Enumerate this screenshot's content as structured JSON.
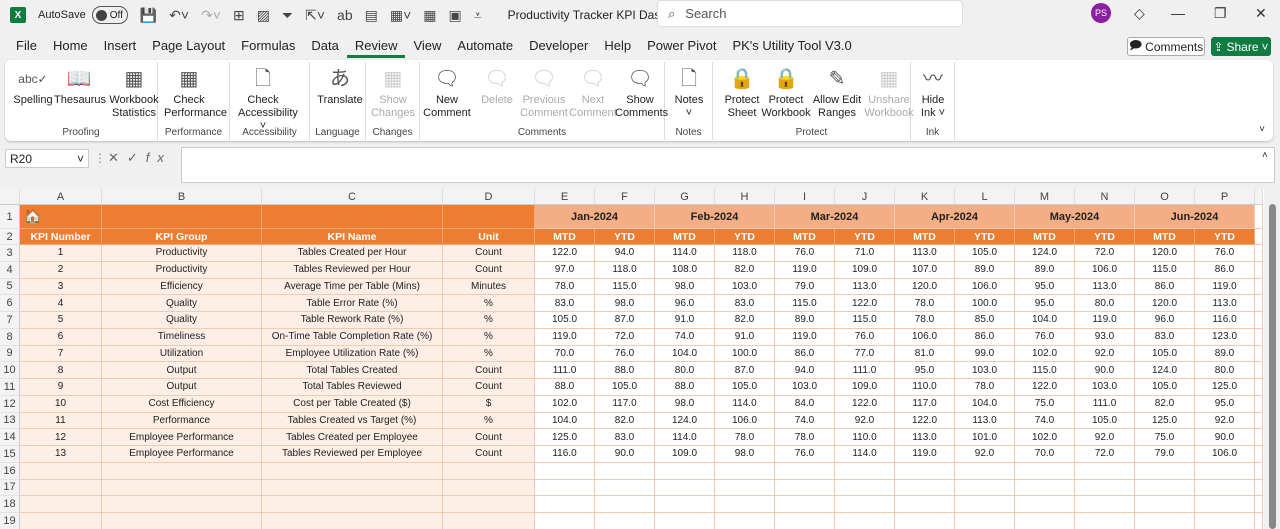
{
  "app": {
    "autosave_label": "AutoSave",
    "autosave_state": "Off",
    "doc_title": "Productivity Tracker KPI Dashb...",
    "search_placeholder": "Search",
    "avatar": "PS"
  },
  "menu_tabs": [
    "File",
    "Home",
    "Insert",
    "Page Layout",
    "Formulas",
    "Data",
    "Review",
    "View",
    "Automate",
    "Developer",
    "Help",
    "Power Pivot",
    "PK's Utility Tool V3.0"
  ],
  "active_tab": "Review",
  "header_buttons": {
    "comments": "Comments",
    "share": "Share"
  },
  "ribbon": {
    "groups": [
      {
        "label": "Proofing",
        "buttons": [
          {
            "l1": "Spelling",
            "l2": "",
            "icon": "spelling-icon",
            "glyph": "abc✓",
            "enabled": true
          },
          {
            "l1": "Thesaurus",
            "l2": "",
            "icon": "thesaurus-icon",
            "glyph": "📖",
            "enabled": true
          },
          {
            "l1": "Workbook",
            "l2": "Statistics",
            "icon": "workbook-statistics-icon",
            "glyph": "▦",
            "enabled": true
          }
        ]
      },
      {
        "label": "Performance",
        "buttons": [
          {
            "l1": "Check",
            "l2": "Performance",
            "icon": "check-performance-icon",
            "glyph": "▦",
            "enabled": true
          }
        ]
      },
      {
        "label": "Accessibility",
        "buttons": [
          {
            "l1": "Check",
            "l2": "Accessibility ˅",
            "icon": "check-accessibility-icon",
            "glyph": "🗋",
            "enabled": true
          }
        ]
      },
      {
        "label": "Language",
        "buttons": [
          {
            "l1": "Translate",
            "l2": "",
            "icon": "translate-icon",
            "glyph": "あ",
            "enabled": true
          }
        ]
      },
      {
        "label": "Changes",
        "buttons": [
          {
            "l1": "Show",
            "l2": "Changes",
            "icon": "show-changes-icon",
            "glyph": "▦",
            "enabled": false
          }
        ]
      },
      {
        "label": "Comments",
        "buttons": [
          {
            "l1": "New",
            "l2": "Comment",
            "icon": "new-comment-icon",
            "glyph": "🗨",
            "enabled": true
          },
          {
            "l1": "Delete",
            "l2": "",
            "icon": "delete-comment-icon",
            "glyph": "🗨",
            "enabled": false
          },
          {
            "l1": "Previous",
            "l2": "Comment",
            "icon": "previous-comment-icon",
            "glyph": "🗨",
            "enabled": false
          },
          {
            "l1": "Next",
            "l2": "Comment",
            "icon": "next-comment-icon",
            "glyph": "🗨",
            "enabled": false
          },
          {
            "l1": "Show",
            "l2": "Comments",
            "icon": "show-comments-icon",
            "glyph": "🗨",
            "enabled": true
          }
        ]
      },
      {
        "label": "Notes",
        "buttons": [
          {
            "l1": "Notes",
            "l2": "˅",
            "icon": "notes-icon",
            "glyph": "🗋",
            "enabled": true
          }
        ]
      },
      {
        "label": "Protect",
        "buttons": [
          {
            "l1": "Protect",
            "l2": "Sheet",
            "icon": "protect-sheet-icon",
            "glyph": "🔒",
            "enabled": true
          },
          {
            "l1": "Protect",
            "l2": "Workbook",
            "icon": "protect-workbook-icon",
            "glyph": "🔒",
            "enabled": true
          },
          {
            "l1": "Allow Edit",
            "l2": "Ranges",
            "icon": "allow-edit-ranges-icon",
            "glyph": "✎",
            "enabled": true
          },
          {
            "l1": "Unshare",
            "l2": "Workbook",
            "icon": "unshare-workbook-icon",
            "glyph": "▦",
            "enabled": false
          }
        ]
      },
      {
        "label": "Ink",
        "buttons": [
          {
            "l1": "Hide",
            "l2": "Ink ˅",
            "icon": "hide-ink-icon",
            "glyph": "〰",
            "enabled": true
          }
        ]
      }
    ]
  },
  "formula_bar": {
    "name_box": "R20",
    "formula": ""
  },
  "sheet": {
    "columns": [
      "A",
      "B",
      "C",
      "D",
      "E",
      "F",
      "G",
      "H",
      "I",
      "J",
      "K",
      "L",
      "M",
      "N",
      "O",
      "P"
    ],
    "row_numbers": [
      1,
      2,
      3,
      4,
      5,
      6,
      7,
      8,
      9,
      10,
      11,
      12,
      13,
      14,
      15,
      16,
      17,
      18,
      19
    ],
    "headers": [
      "KPI Number",
      "KPI Group",
      "KPI Name",
      "Unit"
    ],
    "months": [
      "Jan-2024",
      "Feb-2024",
      "Mar-2024",
      "Apr-2024",
      "May-2024",
      "Jun-2024"
    ],
    "sub_headers": [
      "MTD",
      "YTD"
    ],
    "rows": [
      [
        "1",
        "Productivity",
        "Tables Created per Hour",
        "Count",
        "122.0",
        "94.0",
        "114.0",
        "118.0",
        "76.0",
        "71.0",
        "113.0",
        "105.0",
        "124.0",
        "72.0",
        "120.0",
        "76.0"
      ],
      [
        "2",
        "Productivity",
        "Tables Reviewed per Hour",
        "Count",
        "97.0",
        "118.0",
        "108.0",
        "82.0",
        "119.0",
        "109.0",
        "107.0",
        "89.0",
        "89.0",
        "106.0",
        "115.0",
        "86.0"
      ],
      [
        "3",
        "Efficiency",
        "Average Time per Table (Mins)",
        "Minutes",
        "78.0",
        "115.0",
        "98.0",
        "103.0",
        "79.0",
        "113.0",
        "120.0",
        "106.0",
        "95.0",
        "113.0",
        "86.0",
        "119.0"
      ],
      [
        "4",
        "Quality",
        "Table Error Rate (%)",
        "%",
        "83.0",
        "98.0",
        "96.0",
        "83.0",
        "115.0",
        "122.0",
        "78.0",
        "100.0",
        "95.0",
        "80.0",
        "120.0",
        "113.0"
      ],
      [
        "5",
        "Quality",
        "Table Rework Rate (%)",
        "%",
        "105.0",
        "87.0",
        "91.0",
        "82.0",
        "89.0",
        "115.0",
        "78.0",
        "85.0",
        "104.0",
        "119.0",
        "96.0",
        "116.0"
      ],
      [
        "6",
        "Timeliness",
        "On-Time Table Completion Rate (%)",
        "%",
        "119.0",
        "72.0",
        "74.0",
        "91.0",
        "119.0",
        "76.0",
        "106.0",
        "86.0",
        "76.0",
        "93.0",
        "83.0",
        "123.0"
      ],
      [
        "7",
        "Utilization",
        "Employee Utilization Rate (%)",
        "%",
        "70.0",
        "76.0",
        "104.0",
        "100.0",
        "86.0",
        "77.0",
        "81.0",
        "99.0",
        "102.0",
        "92.0",
        "105.0",
        "89.0"
      ],
      [
        "8",
        "Output",
        "Total Tables Created",
        "Count",
        "111.0",
        "88.0",
        "80.0",
        "87.0",
        "94.0",
        "111.0",
        "95.0",
        "103.0",
        "115.0",
        "90.0",
        "124.0",
        "80.0"
      ],
      [
        "9",
        "Output",
        "Total Tables Reviewed",
        "Count",
        "88.0",
        "105.0",
        "88.0",
        "105.0",
        "103.0",
        "109.0",
        "110.0",
        "78.0",
        "122.0",
        "103.0",
        "105.0",
        "125.0"
      ],
      [
        "10",
        "Cost Efficiency",
        "Cost per Table Created ($)",
        "$",
        "102.0",
        "117.0",
        "98.0",
        "114.0",
        "84.0",
        "122.0",
        "117.0",
        "104.0",
        "75.0",
        "111.0",
        "82.0",
        "95.0"
      ],
      [
        "11",
        "Performance",
        "Tables Created vs Target (%)",
        "%",
        "104.0",
        "82.0",
        "124.0",
        "106.0",
        "74.0",
        "92.0",
        "122.0",
        "113.0",
        "74.0",
        "105.0",
        "125.0",
        "92.0"
      ],
      [
        "12",
        "Employee Performance",
        "Tables Created per Employee",
        "Count",
        "125.0",
        "83.0",
        "114.0",
        "78.0",
        "78.0",
        "110.0",
        "113.0",
        "101.0",
        "102.0",
        "92.0",
        "75.0",
        "90.0"
      ],
      [
        "13",
        "Employee Performance",
        "Tables Reviewed per Employee",
        "Count",
        "116.0",
        "90.0",
        "109.0",
        "98.0",
        "76.0",
        "114.0",
        "119.0",
        "92.0",
        "70.0",
        "72.0",
        "79.0",
        "106.0"
      ]
    ]
  },
  "colors": {
    "header_orange": "#ED7D31",
    "month_header": "#F4AE85",
    "left_body": "#FDEEE6",
    "excel_green": "#107c41"
  }
}
